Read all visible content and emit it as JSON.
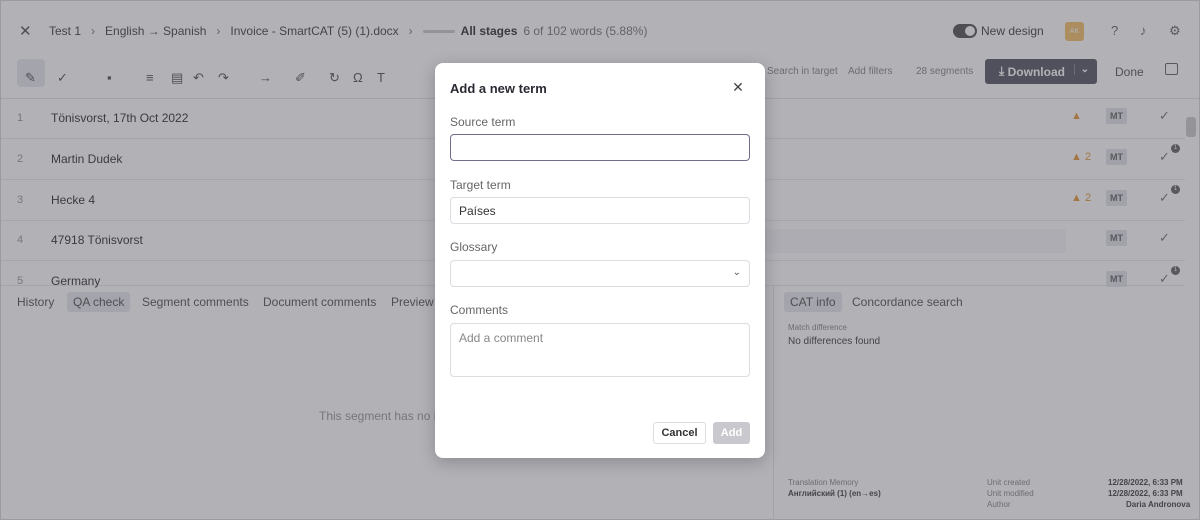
{
  "topbar": {
    "close_icon": "close-icon",
    "breadcrumbs": [
      "Test 1",
      "English → Spanish",
      "Invoice - SmartCAT (5) (1).docx"
    ],
    "stages_label": "All stages",
    "words_progress": "6 of 102 words  (5.88%)",
    "progress_fraction": 0.0588,
    "new_design_label": "New design",
    "avatar_initials": "AK"
  },
  "toolbar": {
    "search_in_target": "Search in target",
    "add_filters": "Add filters",
    "segments_count": "28 segments",
    "download_label": "Download",
    "done_label": "Done"
  },
  "segments": [
    {
      "num": "1",
      "source": "Tönisvorst, 17th Oct 2022",
      "warn": "",
      "mt": "MT"
    },
    {
      "num": "2",
      "source": "Martin Dudek",
      "warn": "2",
      "mt": "MT",
      "badge": "1"
    },
    {
      "num": "3",
      "source": "Hecke 4",
      "warn": "2",
      "mt": "MT",
      "badge": "1"
    },
    {
      "num": "4",
      "source": "47918 Tönisvorst",
      "warn": "",
      "mt": "MT"
    },
    {
      "num": "5",
      "source": "Germany",
      "warn": "",
      "mt": "MT",
      "badge": "1"
    }
  ],
  "bottom_tabs": [
    "History",
    "QA check",
    "Segment comments",
    "Document comments",
    "Preview"
  ],
  "bottom_empty_text": "This segment has no is",
  "right_panel": {
    "tabs": [
      "CAT info",
      "Concordance search"
    ],
    "match_label": "Match difference",
    "match_value": "No differences found",
    "tm_label": "Translation Memory",
    "tm_value": "Английский (1)  (en→es)",
    "unit_created_label": "Unit created",
    "unit_created_value": "12/28/2022, 6:33 PM",
    "unit_modified_label": "Unit modified",
    "unit_modified_value": "12/28/2022, 6:33 PM",
    "author_label": "Author",
    "author_value": "Daria Andronova"
  },
  "modal": {
    "title": "Add a new term",
    "source_label": "Source term",
    "source_value": "",
    "target_label": "Target term",
    "target_value": "Países",
    "glossary_label": "Glossary",
    "glossary_value": "",
    "comments_label": "Comments",
    "comments_placeholder": "Add a comment",
    "cancel_label": "Cancel",
    "add_label": "Add"
  }
}
